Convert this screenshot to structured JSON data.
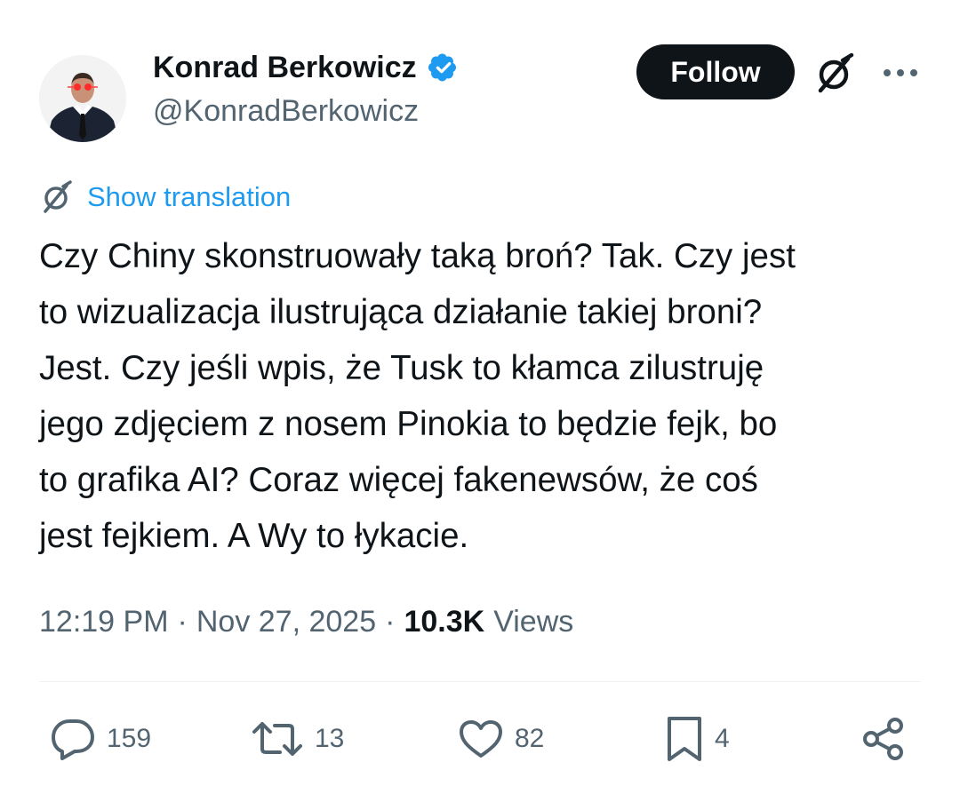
{
  "author": {
    "display_name": "Konrad Berkowicz",
    "handle": "@KonradBerkowicz",
    "verified": true,
    "avatar_icon": "avatar-photo"
  },
  "header": {
    "follow_label": "Follow",
    "grok_icon": "grok-icon",
    "more_icon": "more-options-icon"
  },
  "translation": {
    "label": "Show translation",
    "icon": "grok-icon"
  },
  "tweet": {
    "lines": [
      "Czy Chiny skonstruowały taką broń? Tak. Czy jest",
      "to wizualizacja ilustrująca działanie takiej broni?",
      "Jest. Czy jeśli wpis, że Tusk to kłamca zilustruję",
      "jego zdjęciem z nosem Pinokia to będzie fejk, bo",
      "to grafika AI? Coraz więcej fakenewsów, że coś",
      "jest fejkiem. A Wy to łykacie."
    ]
  },
  "meta": {
    "time": "12:19 PM",
    "separator": "·",
    "date": "Nov 27, 2025",
    "views_count": "10.3K",
    "views_label": "Views"
  },
  "actions": {
    "reply": "159",
    "retweet": "13",
    "like": "82",
    "bookmark": "4"
  },
  "colors": {
    "text_primary": "#0f1419",
    "text_secondary": "#536471",
    "accent": "#1d9bf0",
    "follow_bg": "#0f1419",
    "divider": "#eff3f4"
  }
}
